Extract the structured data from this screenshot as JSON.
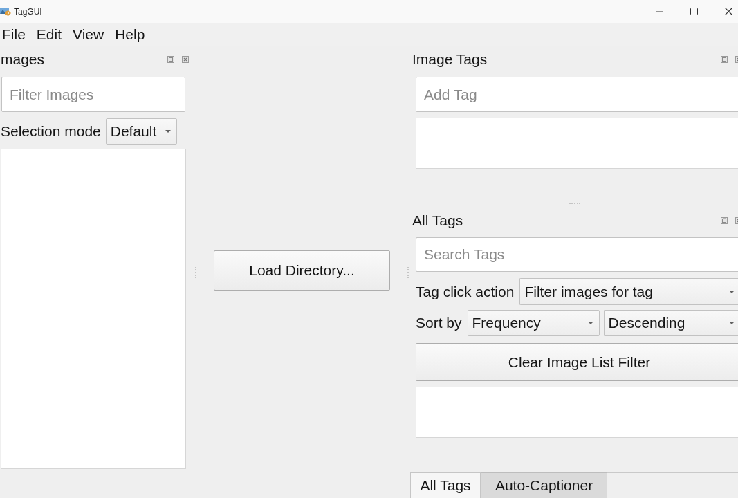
{
  "window": {
    "title": "TagGUI"
  },
  "menu": [
    "File",
    "Edit",
    "View",
    "Help"
  ],
  "images_dock": {
    "title": "mages",
    "filter": {
      "placeholder": "Filter Images"
    },
    "selection_mode": {
      "label": "Selection mode",
      "value": "Default"
    }
  },
  "center": {
    "load_button": "Load Directory..."
  },
  "image_tags_dock": {
    "title": "Image Tags",
    "add_tag": {
      "placeholder": "Add Tag"
    }
  },
  "all_tags_dock": {
    "title": "All Tags",
    "search": {
      "placeholder": "Search Tags"
    },
    "tag_click_action": {
      "label": "Tag click action",
      "value": "Filter images for tag"
    },
    "sort_by": {
      "label": "Sort by",
      "field": "Frequency",
      "order": "Descending"
    },
    "clear_button": "Clear Image List Filter"
  },
  "tabs": [
    {
      "label": "All Tags",
      "selected": true
    },
    {
      "label": "Auto-Captioner",
      "selected": false
    }
  ]
}
